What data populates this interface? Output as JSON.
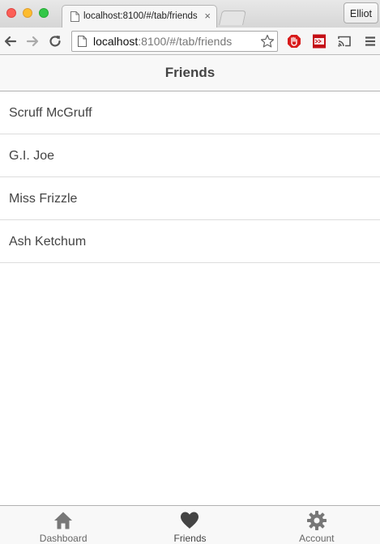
{
  "browser": {
    "tab_title": "localhost:8100/#/tab/friends",
    "tab_close_glyph": "×",
    "profile_name": "Elliot",
    "url_host": "localhost",
    "url_rest": ":8100/#/tab/friends",
    "icons": [
      "page-icon",
      "back-arrow-icon",
      "forward-arrow-icon",
      "reload-icon",
      "bookmark-star-icon",
      "stop-extension-icon",
      "red-extension-icon",
      "cast-icon",
      "menu-icon"
    ]
  },
  "app": {
    "header_title": "Friends",
    "friends": [
      {
        "name": "Scruff McGruff"
      },
      {
        "name": "G.I. Joe"
      },
      {
        "name": "Miss Frizzle"
      },
      {
        "name": "Ash Ketchum"
      }
    ],
    "tabs": [
      {
        "label": "Dashboard",
        "icon": "home-icon",
        "active": false
      },
      {
        "label": "Friends",
        "icon": "heart-icon",
        "active": true
      },
      {
        "label": "Account",
        "icon": "gear-icon",
        "active": false
      }
    ],
    "colors": {
      "icon_inactive": "#777777",
      "icon_active": "#444444",
      "header_bg": "#f8f8f8"
    }
  }
}
